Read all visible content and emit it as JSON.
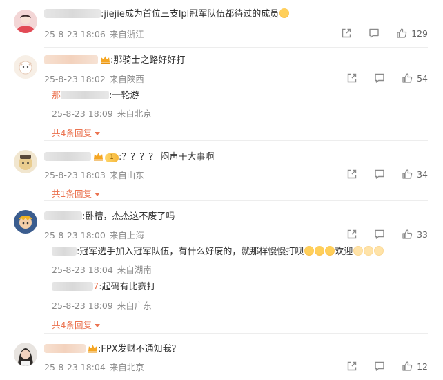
{
  "comments": [
    {
      "text": ":jiejie成为首位三支lpl冠军队伍都待过的成员",
      "time": "25-8-23 18:06",
      "location": "来自浙江",
      "likes": "129"
    },
    {
      "text": ":那骑士之路好好打",
      "time": "25-8-23 18:02",
      "location": "来自陕西",
      "likes": "54",
      "replies": [
        {
          "prefix": "那",
          "text": ":一轮游",
          "time": "25-8-23 18:09",
          "location": "来自北京"
        }
      ],
      "more": "共4条回复"
    },
    {
      "level": "1",
      "text": ":？？？？ 闷声干大事啊",
      "time": "25-8-23 18:03",
      "location": "来自山东",
      "likes": "34",
      "more": "共1条回复"
    },
    {
      "text": ":卧槽，杰杰这不废了吗",
      "time": "25-8-23 18:00",
      "location": "来自上海",
      "likes": "33",
      "replies": [
        {
          "text": ":冠军选手加入冠军队伍，有什么好废的，就那样慢慢打呗",
          "after": "欢迎",
          "time": "25-8-23 18:04",
          "location": "来自湖南"
        },
        {
          "suffix": "7",
          "text": ":起码有比赛打",
          "time": "25-8-23 18:09",
          "location": "来自广东"
        }
      ],
      "more": "共4条回复"
    },
    {
      "text": ":FPX发财不通知我？",
      "time": "25-8-23 18:04",
      "location": "来自北京",
      "likes": "12"
    }
  ],
  "icons": {
    "share": "share-icon",
    "comment": "comment-icon",
    "like": "thumbs-up-icon",
    "crown": "crown-icon"
  },
  "colors": {
    "accent": "#eb7350",
    "meta": "#8a8a8a"
  }
}
